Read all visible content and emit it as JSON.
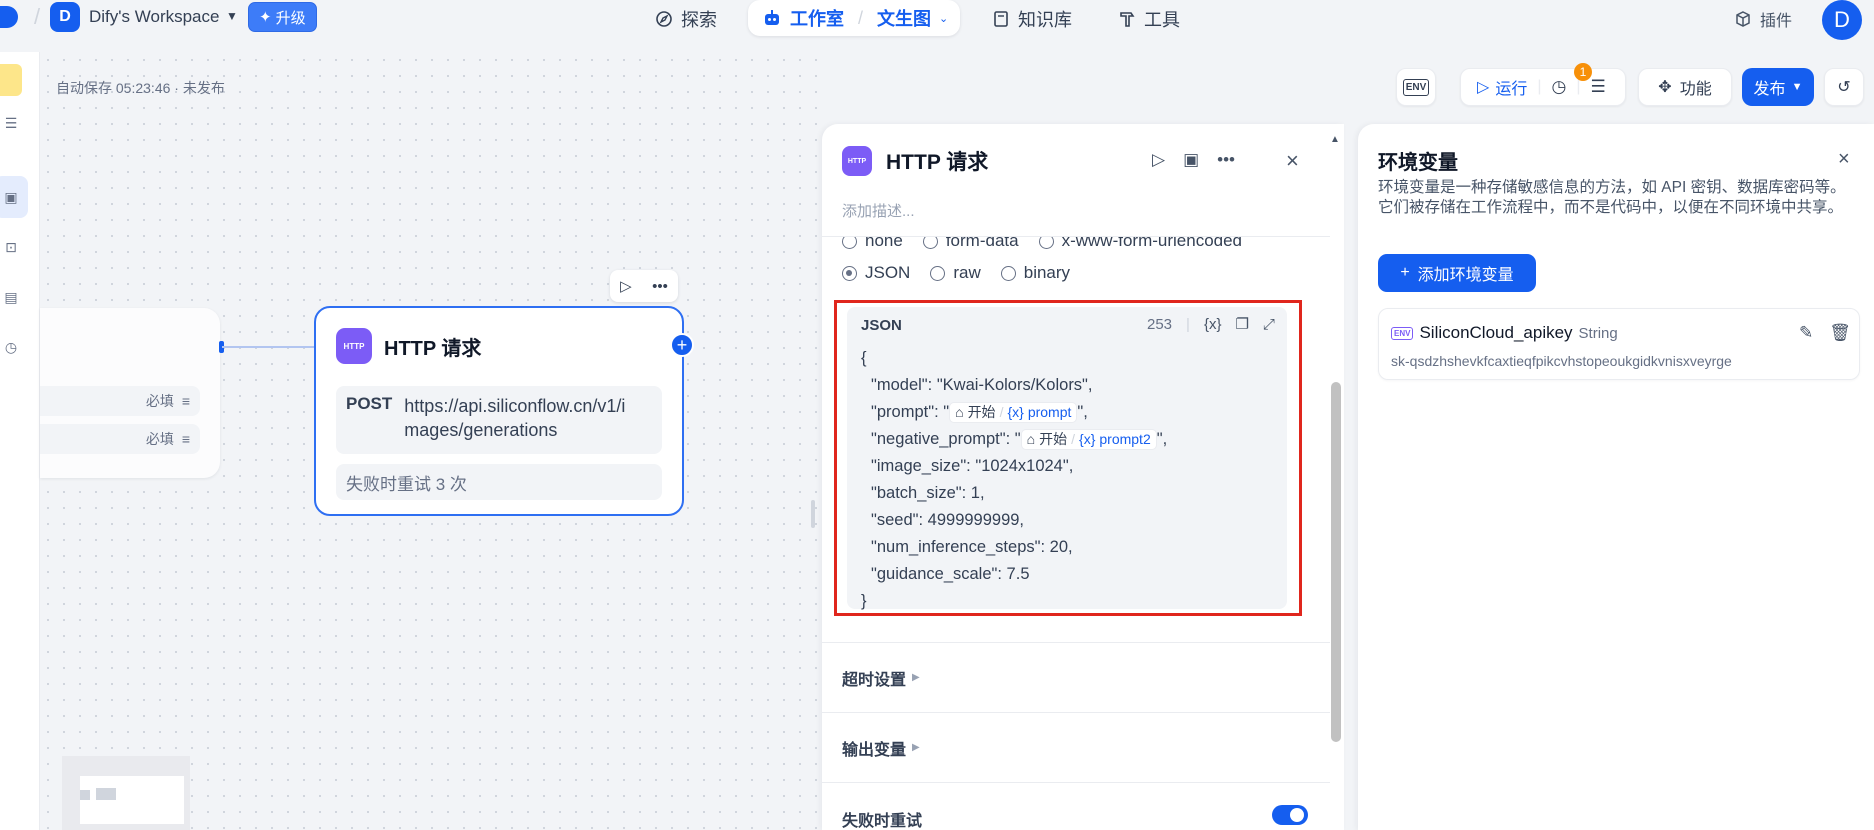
{
  "header": {
    "workspace_initial": "D",
    "workspace_name": "Dify's Workspace",
    "upgrade_label": "升级",
    "nav": {
      "explore": "探索",
      "studio": "工作室",
      "app_name": "文生图",
      "knowledge": "知识库",
      "tools": "工具"
    },
    "plugin_label": "插件",
    "user_initial": "D"
  },
  "canvas": {
    "autosave": "自动保存 05:23:46 · 未发布",
    "start_node": {
      "rows": [
        {
          "tag": "必填"
        },
        {
          "tag": "必填"
        }
      ]
    },
    "http_node": {
      "badge": "HTTP",
      "title": "HTTP 请求",
      "method": "POST",
      "url": "https://api.siliconflow.cn/v1/images/generations",
      "retry": "失败时重试 3 次"
    }
  },
  "toolbar": {
    "env_label": "ENV",
    "run_label": "运行",
    "badge_count": "1",
    "features_label": "功能",
    "publish_label": "发布"
  },
  "panel": {
    "badge": "HTTP",
    "title": "HTTP 请求",
    "description_placeholder": "添加描述...",
    "body_types_row1": [
      "none",
      "form-data",
      "x-www-form-urlencoded"
    ],
    "body_types_row2": [
      "JSON",
      "raw",
      "binary"
    ],
    "selected_body_type": "JSON",
    "json": {
      "label": "JSON",
      "char_count": "253",
      "lines": {
        "open": "{",
        "model": "\"model\": \"Kwai-Kolors/Kolors\",",
        "prompt_key": "\"prompt\": \"",
        "prompt_end": "\",",
        "neg_key": "\"negative_prompt\": \"",
        "neg_end": "\",",
        "image_size": "\"image_size\": \"1024x1024\",",
        "batch_size": "\"batch_size\": 1,",
        "seed": "\"seed\": 4999999999,",
        "steps": "\"num_inference_steps\": 20,",
        "guidance": "\"guidance_scale\": 7.5",
        "close": "}"
      },
      "var_source": "开始",
      "var_prompt": "prompt",
      "var_prompt2": "prompt2"
    },
    "sections": {
      "timeout": "超时设置",
      "output": "输出变量",
      "retry": "失败时重试"
    },
    "retry_enabled": true
  },
  "env_panel": {
    "title": "环境变量",
    "description": "环境变量是一种存储敏感信息的方法，如 API 密钥、数据库密码等。它们被存储在工作流程中，而不是代码中，以便在不同环境中共享。",
    "add_label": "添加环境变量",
    "variable": {
      "icon_label": "ENV",
      "name": "SiliconCloud_apikey",
      "type": "String",
      "value": "sk-qsdzhshevkfcaxtieqfpikcvhstopeoukgidkvnisxveyrge"
    }
  },
  "colors": {
    "accent": "#155eef",
    "http_badge": "#7c5cf6",
    "highlight_border": "#e0261d",
    "badge_orange": "#f79009"
  }
}
